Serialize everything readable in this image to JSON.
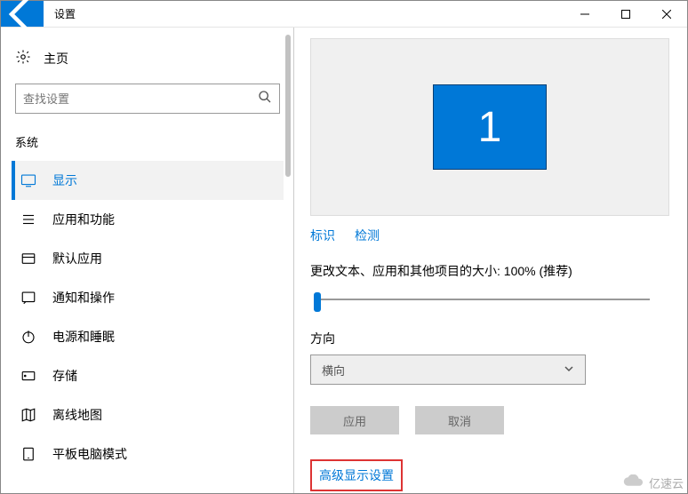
{
  "titlebar": {
    "title": "设置"
  },
  "sidebar": {
    "home": "主页",
    "search_placeholder": "查找设置",
    "group": "系统",
    "items": [
      {
        "label": "显示",
        "active": true
      },
      {
        "label": "应用和功能",
        "active": false
      },
      {
        "label": "默认应用",
        "active": false
      },
      {
        "label": "通知和操作",
        "active": false
      },
      {
        "label": "电源和睡眠",
        "active": false
      },
      {
        "label": "存储",
        "active": false
      },
      {
        "label": "离线地图",
        "active": false
      },
      {
        "label": "平板电脑模式",
        "active": false
      }
    ]
  },
  "main": {
    "monitor_number": "1",
    "identify": "标识",
    "detect": "检测",
    "scale_label": "更改文本、应用和其他项目的大小: 100% (推荐)",
    "orientation_label": "方向",
    "orientation_value": "横向",
    "apply": "应用",
    "cancel": "取消",
    "advanced": "高级显示设置"
  },
  "watermark": "亿速云"
}
